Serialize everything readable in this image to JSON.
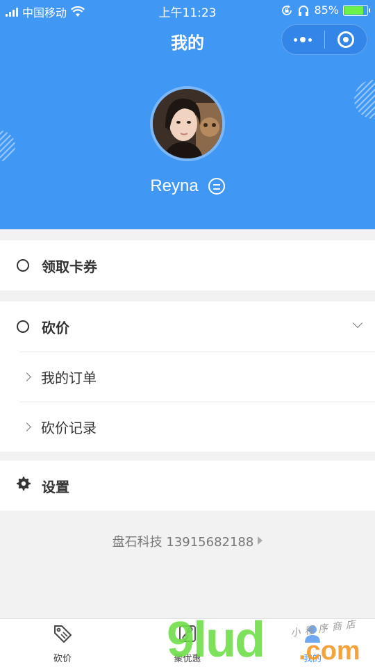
{
  "status_bar": {
    "carrier": "中国移动",
    "time": "上午11:23",
    "battery_percent": "85%"
  },
  "header": {
    "title": "我的",
    "background_color": "#4197f4"
  },
  "profile": {
    "username": "Reyna"
  },
  "menu": {
    "coupons_label": "领取卡券",
    "bargain_label": "砍价",
    "my_orders_label": "我的订单",
    "bargain_records_label": "砍价记录",
    "settings_label": "设置"
  },
  "footer": {
    "credit": "盘石科技 13915682188"
  },
  "tabbar": {
    "tabs": [
      {
        "label": "砍价",
        "icon": "price-tag-icon"
      },
      {
        "label": "聚优惠",
        "icon": "link-icon"
      },
      {
        "label": "我的",
        "icon": "user-icon"
      }
    ]
  },
  "watermark": {
    "brand": "9lud",
    "domain": ".com",
    "tagline": "小程序商店"
  }
}
